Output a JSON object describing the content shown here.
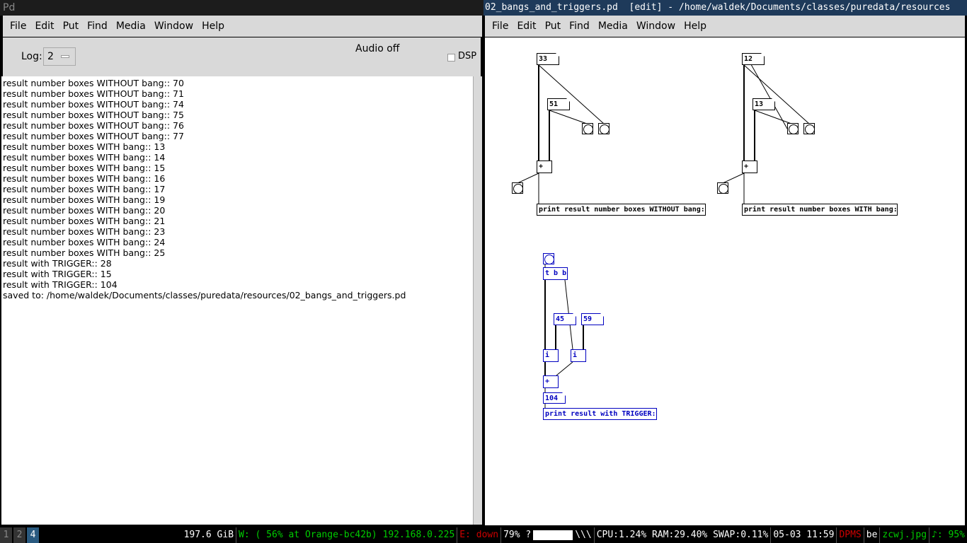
{
  "console_window": {
    "title": "Pd",
    "menu": [
      "File",
      "Edit",
      "Put",
      "Find",
      "Media",
      "Window",
      "Help"
    ],
    "log_label": "Log:",
    "log_value": "2",
    "audio_status": "Audio off",
    "dsp_label": "DSP",
    "dsp_checked": false,
    "lines": [
      "result number boxes WITHOUT bang:: 70",
      "result number boxes WITHOUT bang:: 71",
      "result number boxes WITHOUT bang:: 74",
      "result number boxes WITHOUT bang:: 75",
      "result number boxes WITHOUT bang:: 76",
      "result number boxes WITHOUT bang:: 77",
      "result number boxes WITH bang:: 13",
      "result number boxes WITH bang:: 14",
      "result number boxes WITH bang:: 15",
      "result number boxes WITH bang:: 16",
      "result number boxes WITH bang:: 17",
      "result number boxes WITH bang:: 19",
      "result number boxes WITH bang:: 20",
      "result number boxes WITH bang:: 21",
      "result number boxes WITH bang:: 23",
      "result number boxes WITH bang:: 24",
      "result number boxes WITH bang:: 25",
      "result with TRIGGER:: 28",
      "result with TRIGGER:: 15",
      "result with TRIGGER:: 104",
      "saved to: /home/waldek/Documents/classes/puredata/resources/02_bangs_and_triggers.pd"
    ]
  },
  "patch_window": {
    "title": "02_bangs_and_triggers.pd  [edit] - /home/waldek/Documents/classes/puredata/resources",
    "menu": [
      "File",
      "Edit",
      "Put",
      "Find",
      "Media",
      "Window",
      "Help"
    ],
    "objects": {
      "n1": "33",
      "n2": "51",
      "add1": "+",
      "print1": "print result number boxes WITHOUT bang:",
      "n3": "12",
      "n4": "13",
      "add2": "+",
      "print2": "print result number boxes WITH bang:",
      "trigger": "t b b",
      "n5": "45",
      "n6": "59",
      "i1": "i",
      "i2": "i",
      "add3": "+",
      "n7": "104",
      "print3": "print result with TRIGGER:"
    }
  },
  "statusbar": {
    "workspaces": [
      "1",
      "2",
      "4"
    ],
    "active_workspace": "4",
    "disk": "197.6 GiB",
    "wifi": "W: ( 56% at Orange-bc42b) 192.168.0.225",
    "ethernet": "E: down",
    "battery": "79% ?",
    "load": "\\\\\\",
    "cpu": "CPU:1.24% RAM:29.40% SWAP:0.11%",
    "datetime": "05-03 11:59",
    "dpms": "DPMS",
    "kbd": "be",
    "wallpaper": "zcwj.jpg",
    "volume": "♪: 95%",
    "colors": {
      "green": "#00cc00",
      "red": "#cc0000",
      "text": "#ffffff"
    }
  }
}
